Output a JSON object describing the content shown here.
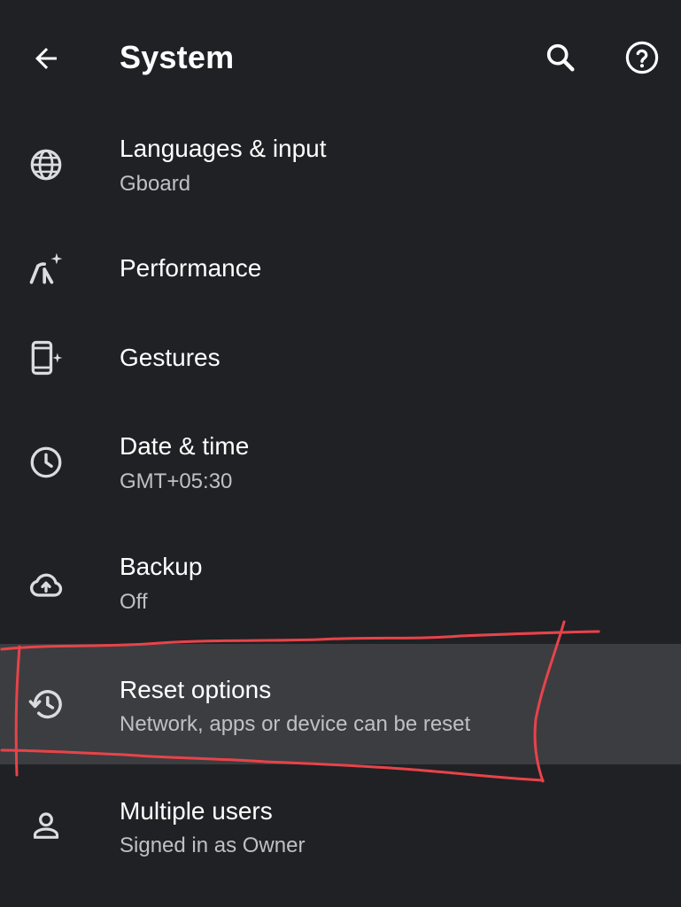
{
  "header": {
    "title": "System"
  },
  "items": [
    {
      "label": "Languages & input",
      "sub": "Gboard"
    },
    {
      "label": "Performance",
      "sub": ""
    },
    {
      "label": "Gestures",
      "sub": ""
    },
    {
      "label": "Date & time",
      "sub": "GMT+05:30"
    },
    {
      "label": "Backup",
      "sub": "Off"
    },
    {
      "label": "Reset options",
      "sub": "Network, apps or device can be reset"
    },
    {
      "label": "Multiple users",
      "sub": "Signed in as Owner"
    }
  ],
  "colors": {
    "background": "#202124",
    "highlight": "#3c3d40",
    "primary_text": "#ffffff",
    "secondary_text": "#bdc1c6",
    "icon": "#dadce0",
    "annotation": "#e8434a"
  },
  "icons": {
    "back": "arrow-left-icon",
    "search": "search-icon",
    "help": "help-circle-icon",
    "languages": "globe-icon",
    "performance": "speedometer-sparkle-icon",
    "gestures": "phone-sparkle-icon",
    "date_time": "clock-icon",
    "backup": "cloud-upload-icon",
    "reset": "history-icon",
    "users": "person-icon"
  }
}
